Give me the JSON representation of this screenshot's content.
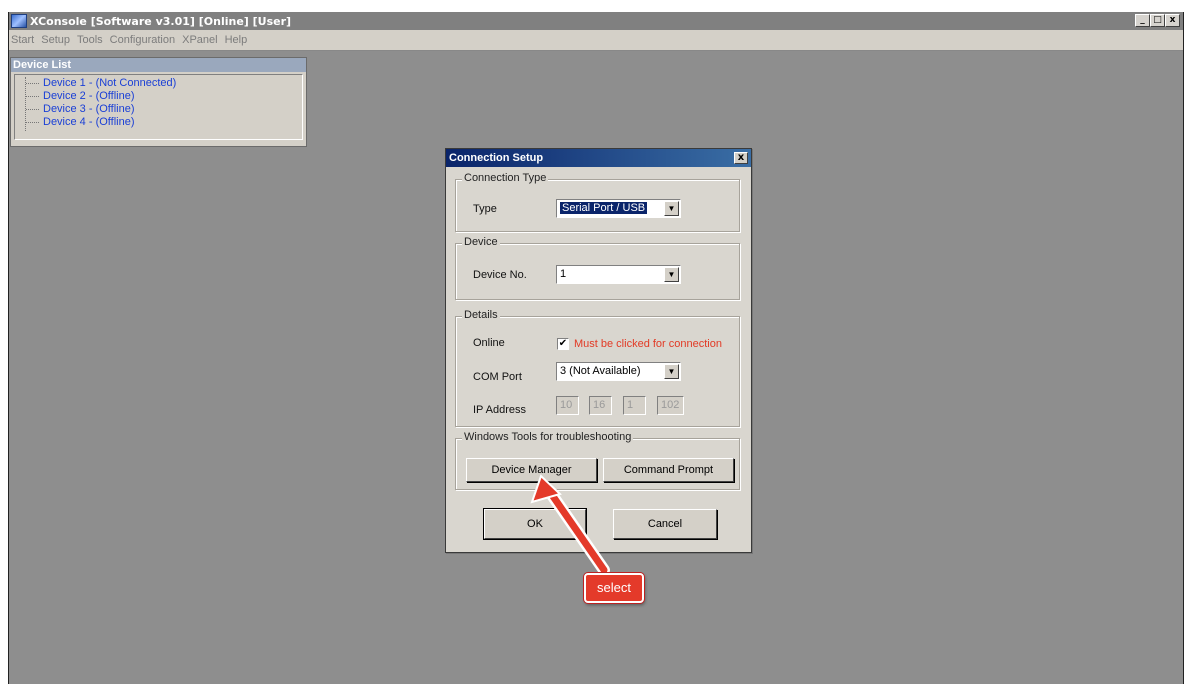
{
  "app": {
    "title": "XConsole [Software v3.01] [Online] [User]",
    "window_buttons": {
      "minimize": "_",
      "maximize": "□",
      "close": "x"
    }
  },
  "menu": [
    "Start",
    "Setup",
    "Tools",
    "Configuration",
    "XPanel",
    "Help"
  ],
  "device_list": {
    "header": "Device List",
    "items": [
      "Device 1 - (Not Connected)",
      "Device 2 - (Offline)",
      "Device 3 - (Offline)",
      "Device 4 - (Offline)"
    ]
  },
  "dialog": {
    "title": "Connection Setup",
    "close_glyph": "x",
    "connection_type": {
      "group_label": "Connection Type",
      "type_label": "Type",
      "type_value": "Serial Port / USB"
    },
    "device": {
      "group_label": "Device",
      "device_no_label": "Device No.",
      "device_no_value": "1"
    },
    "details": {
      "group_label": "Details",
      "online_label": "Online",
      "online_checked": true,
      "online_check_glyph": "✔",
      "online_note": "Must be clicked for connection",
      "com_port_label": "COM Port",
      "com_port_value": "3 (Not Available)",
      "ip_label": "IP Address",
      "ip_octets": [
        "10",
        "16",
        "1",
        "102"
      ]
    },
    "tools": {
      "group_label": "Windows Tools for troubleshooting",
      "device_manager": "Device Manager",
      "command_prompt": "Command Prompt"
    },
    "ok_label": "OK",
    "cancel_label": "Cancel"
  },
  "annotation": {
    "callout_text": "select",
    "color": "#e43a2a"
  },
  "colors": {
    "workspace": "#8e8e8e",
    "dialog_title": "#0a246a",
    "tree_text": "#1a3fd6",
    "warning_text": "#e23a25"
  }
}
